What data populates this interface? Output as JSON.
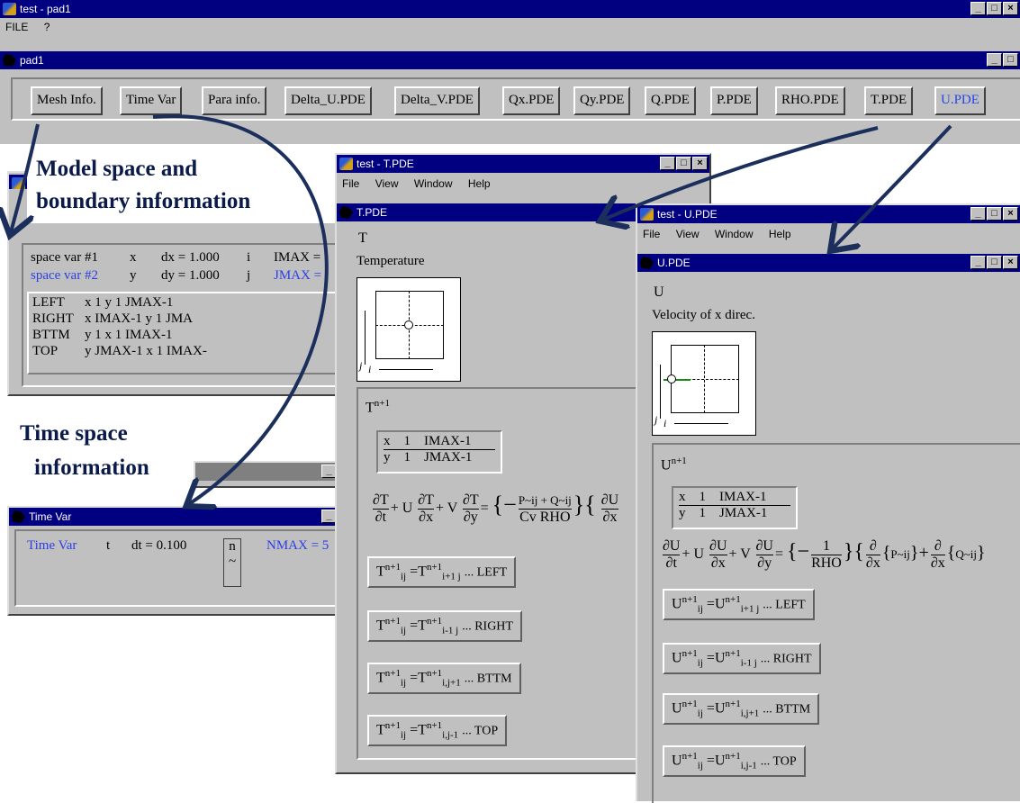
{
  "main_window": {
    "title": "test - pad1",
    "menu": [
      "FILE",
      "?"
    ]
  },
  "pad_window": {
    "title": "pad1",
    "tabs": [
      "Mesh Info.",
      "Time Var",
      "Para info.",
      "Delta_U.PDE",
      "Delta_V.PDE",
      "Qx.PDE",
      "Qy.PDE",
      "Q.PDE",
      "P.PDE",
      "RHO.PDE",
      "T.PDE",
      "U.PDE"
    ]
  },
  "annotations": {
    "model_line1": "Model space and",
    "model_line2": "boundary information",
    "time_line1": "Time space",
    "time_line2": "information"
  },
  "mesh": {
    "rows": [
      {
        "label": "space var #1",
        "var": "x",
        "d": "dx = 1.000",
        "idx": "i",
        "max": "IMAX ="
      },
      {
        "label": "space var #2",
        "var": "y",
        "d": "dy = 1.000",
        "idx": "j",
        "max": "JMAX ="
      }
    ],
    "boundaries": [
      {
        "name": "LEFT",
        "text": "x    1   y   1   JMAX-1"
      },
      {
        "name": "RIGHT",
        "text": "x    IMAX-1   y   1   JMA"
      },
      {
        "name": "BTTM",
        "text": "y    1   x   1   IMAX-1"
      },
      {
        "name": "TOP",
        "text": "y    JMAX-1   x   1   IMAX-"
      }
    ]
  },
  "time_window": {
    "title": "Time Var",
    "label": "Time Var",
    "t": "t",
    "dt": "dt = 0.100",
    "n": "n",
    "tilde": "~",
    "nmax": "NMAX = 5"
  },
  "t_window": {
    "app_title": "test - T.PDE",
    "menu": [
      "File",
      "View",
      "Window",
      "Help"
    ],
    "child_title": "T.PDE",
    "var": "T",
    "desc": "Temperature",
    "grid_i": "i",
    "grid_j": "j",
    "head": "T",
    "head_sup": "n+1",
    "range": [
      "x    1    IMAX-1",
      "y    1    JMAX-1"
    ],
    "eq": {
      "t1n": "∂T",
      "t1d": "∂t",
      "plus1": "+ U",
      "t2n": "∂T",
      "t2d": "∂x",
      "plus2": "+ V",
      "t3n": "∂T",
      "t3d": "∂y",
      "eqs": "=",
      "fn": "P~ij + Q~ij",
      "fd": "Cv RHO",
      "tail_n": "∂U",
      "tail_d": "∂x"
    },
    "bcs": [
      {
        "lhs": "T",
        "lsub": "ij",
        "rsub": "i+1 j",
        "side": "... LEFT"
      },
      {
        "lhs": "T",
        "lsub": "ij",
        "rsub": "i-1 j",
        "side": "... RIGHT"
      },
      {
        "lhs": "T",
        "lsub": "ij",
        "rsub": "i,j+1",
        "side": "... BTTM"
      },
      {
        "lhs": "T",
        "lsub": "ij",
        "rsub": "i,j-1",
        "side": "... TOP"
      }
    ]
  },
  "u_window": {
    "app_title": "test - U.PDE",
    "menu": [
      "File",
      "View",
      "Window",
      "Help"
    ],
    "child_title": "U.PDE",
    "var": "U",
    "desc": "Velocity of x direc.",
    "grid_i": "i",
    "grid_j": "j",
    "head": "U",
    "head_sup": "n+1",
    "range": [
      "x    1    IMAX-1",
      "y    1    JMAX-1"
    ],
    "eq": {
      "t1n": "∂U",
      "t1d": "∂t",
      "plus1": "+ U",
      "t2n": "∂U",
      "t2d": "∂x",
      "plus2": "+ V",
      "t3n": "∂U",
      "t3d": "∂y",
      "eqs": "=",
      "fn": "1",
      "fd": "RHO",
      "dx1n": "∂",
      "dx1d": "∂x",
      "p": "P~ij",
      "dx2n": "∂",
      "dx2d": "∂x",
      "q": "Q~ij"
    },
    "bcs": [
      {
        "lhs": "U",
        "lsub": "ij",
        "rsub": "i+1 j",
        "side": "... LEFT"
      },
      {
        "lhs": "U",
        "lsub": "ij",
        "rsub": "i-1 j",
        "side": "... RIGHT"
      },
      {
        "lhs": "U",
        "lsub": "ij",
        "rsub": "i,j+1",
        "side": "... BTTM"
      },
      {
        "lhs": "U",
        "lsub": "ij",
        "rsub": "i,j-1",
        "side": "... TOP"
      }
    ]
  },
  "colors": {
    "title_active": "#000080",
    "face": "#c0c0c0",
    "link_blue": "#2a3fe6",
    "annotation": "#0a1a4a",
    "arrow": "#1c2f5c"
  }
}
